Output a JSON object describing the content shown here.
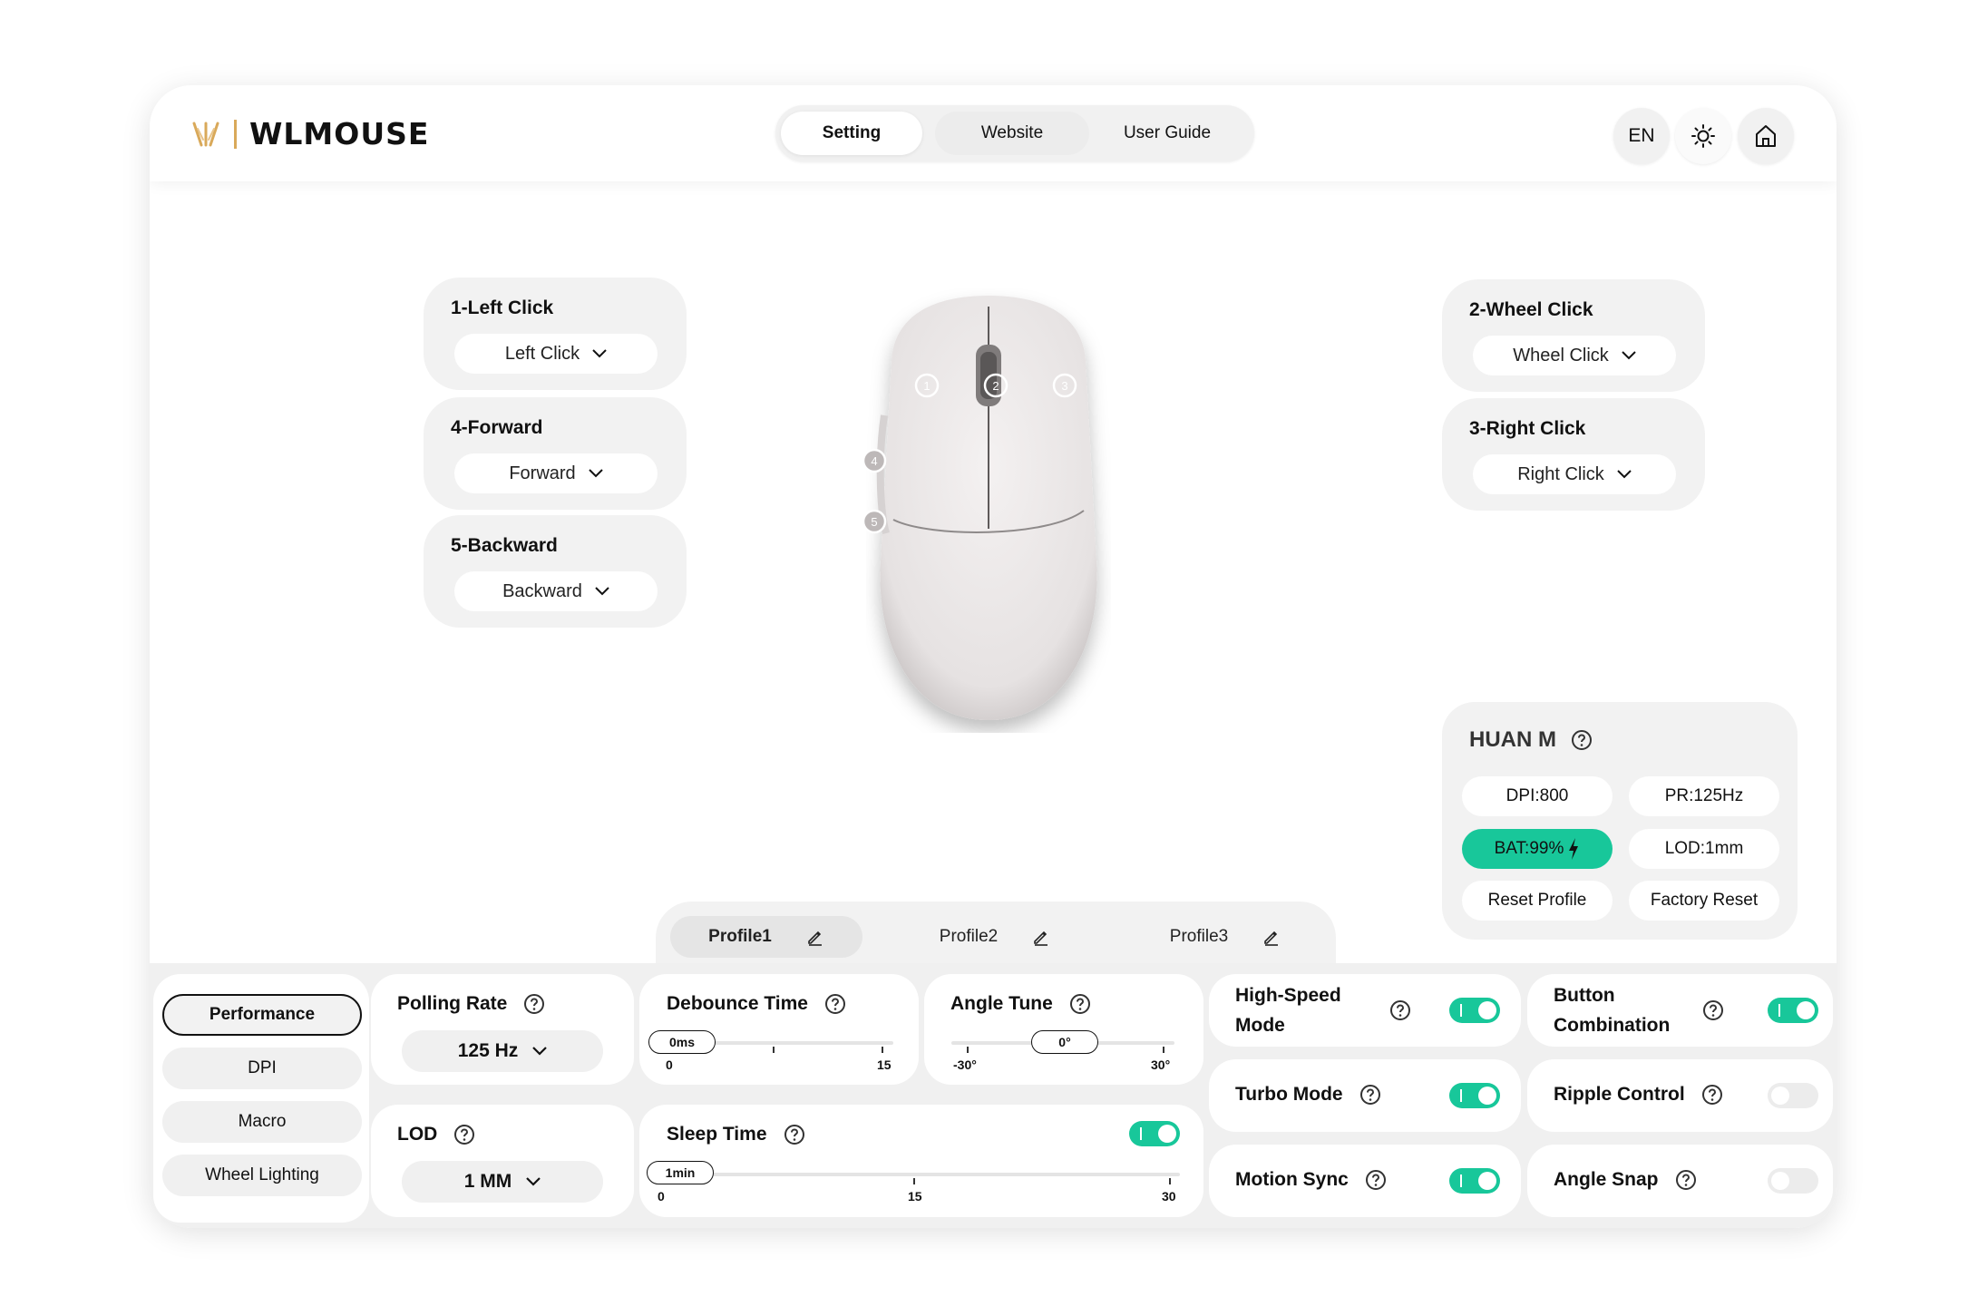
{
  "header": {
    "brand": "WLMOUSE",
    "nav": [
      {
        "label": "Setting",
        "active": true
      },
      {
        "label": "Website",
        "active": false
      },
      {
        "label": "User Guide",
        "active": false
      }
    ],
    "language": "EN"
  },
  "keys": {
    "left_click": {
      "title": "1-Left Click",
      "value": "Left Click"
    },
    "forward": {
      "title": "4-Forward",
      "value": "Forward"
    },
    "backward": {
      "title": "5-Backward",
      "value": "Backward"
    },
    "wheel_click": {
      "title": "2-Wheel Click",
      "value": "Wheel Click"
    },
    "right_click": {
      "title": "3-Right Click",
      "value": "Right Click"
    }
  },
  "mouse_markers": [
    "1",
    "2",
    "3",
    "4",
    "5"
  ],
  "device": {
    "name": "HUAN M",
    "dpi": "DPI:800",
    "polling": "PR:125Hz",
    "battery": "BAT:99%",
    "lod": "LOD:1mm",
    "reset_profile": "Reset Profile",
    "factory_reset": "Factory Reset"
  },
  "profiles": [
    {
      "label": "Profile1",
      "active": true
    },
    {
      "label": "Profile2",
      "active": false
    },
    {
      "label": "Profile3",
      "active": false
    }
  ],
  "sidebar": {
    "items": [
      {
        "label": "Performance",
        "active": true
      },
      {
        "label": "DPI",
        "active": false
      },
      {
        "label": "Macro",
        "active": false
      },
      {
        "label": "Wheel Lighting",
        "active": false
      }
    ]
  },
  "performance": {
    "polling_rate": {
      "title": "Polling Rate",
      "value": "125 Hz"
    },
    "lod": {
      "title": "LOD",
      "value": "1 MM"
    },
    "debounce": {
      "title": "Debounce Time",
      "value": "0ms",
      "min": "0",
      "max": "15",
      "level": 0
    },
    "angle_tune": {
      "title": "Angle Tune",
      "value": "0°",
      "min": "-30°",
      "max": "30°",
      "level": 0.5
    },
    "sleep_time": {
      "title": "Sleep Time",
      "value": "1min",
      "min": "0",
      "mid": "15",
      "max": "30",
      "level": 0,
      "enabled": true
    },
    "toggles": {
      "high_speed": {
        "label_line1": "High-Speed",
        "label_line2": "Mode",
        "on": true
      },
      "button_combination": {
        "label_line1": "Button",
        "label_line2": "Combination",
        "on": true
      },
      "turbo_mode": {
        "label": "Turbo Mode",
        "on": true
      },
      "ripple_control": {
        "label": "Ripple Control",
        "on": false
      },
      "motion_sync": {
        "label": "Motion Sync",
        "on": true
      },
      "angle_snap": {
        "label": "Angle Snap",
        "on": false
      }
    }
  },
  "colors": {
    "accent": "#18c79a",
    "logo": "#d9a95a"
  }
}
